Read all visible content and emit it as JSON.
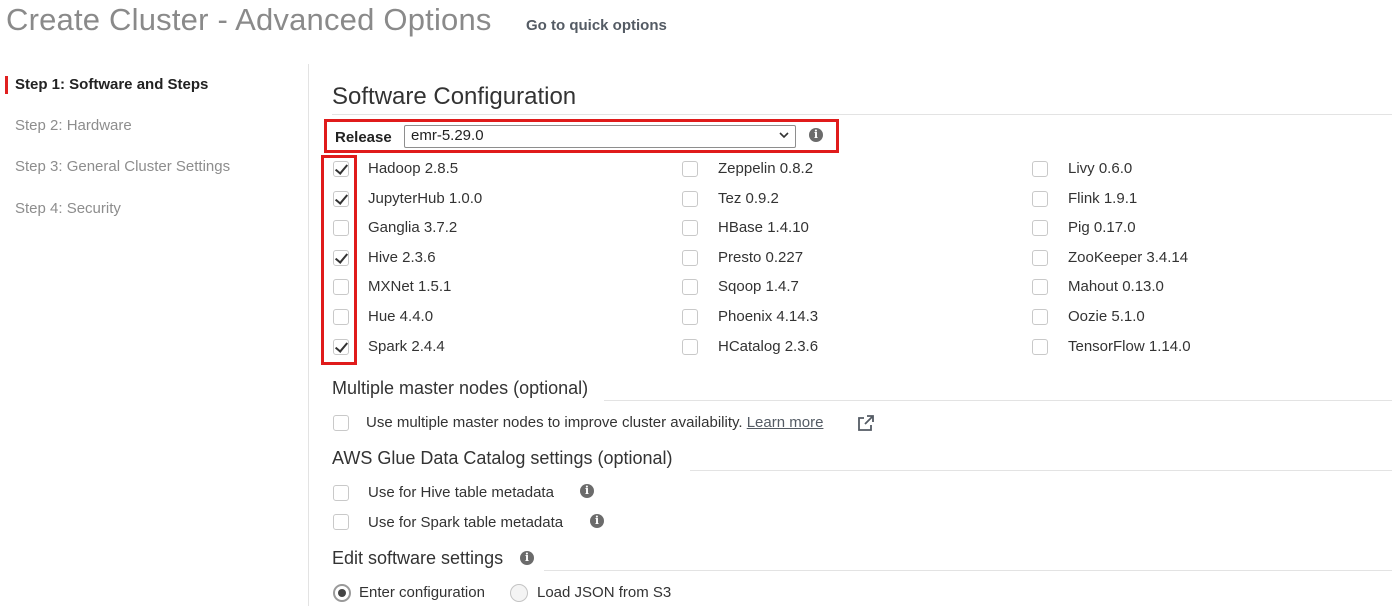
{
  "header": {
    "title": "Create Cluster - Advanced Options",
    "quick_link": "Go to quick options"
  },
  "sidebar": {
    "steps": [
      {
        "label": "Step 1: Software and Steps",
        "active": true
      },
      {
        "label": "Step 2: Hardware",
        "active": false
      },
      {
        "label": "Step 3: General Cluster Settings",
        "active": false
      },
      {
        "label": "Step 4: Security",
        "active": false
      }
    ]
  },
  "software": {
    "section_title": "Software Configuration",
    "release_label": "Release",
    "release_value": "emr-5.29.0",
    "applications": [
      [
        {
          "label": "Hadoop 2.8.5",
          "checked": true
        },
        {
          "label": "JupyterHub 1.0.0",
          "checked": true
        },
        {
          "label": "Ganglia 3.7.2",
          "checked": false
        },
        {
          "label": "Hive 2.3.6",
          "checked": true
        },
        {
          "label": "MXNet 1.5.1",
          "checked": false
        },
        {
          "label": "Hue 4.4.0",
          "checked": false
        },
        {
          "label": "Spark 2.4.4",
          "checked": true
        }
      ],
      [
        {
          "label": "Zeppelin 0.8.2",
          "checked": false
        },
        {
          "label": "Tez 0.9.2",
          "checked": false
        },
        {
          "label": "HBase 1.4.10",
          "checked": false
        },
        {
          "label": "Presto 0.227",
          "checked": false
        },
        {
          "label": "Sqoop 1.4.7",
          "checked": false
        },
        {
          "label": "Phoenix 4.14.3",
          "checked": false
        },
        {
          "label": "HCatalog 2.3.6",
          "checked": false
        }
      ],
      [
        {
          "label": "Livy 0.6.0",
          "checked": false
        },
        {
          "label": "Flink 1.9.1",
          "checked": false
        },
        {
          "label": "Pig 0.17.0",
          "checked": false
        },
        {
          "label": "ZooKeeper 3.4.14",
          "checked": false
        },
        {
          "label": "Mahout 0.13.0",
          "checked": false
        },
        {
          "label": "Oozie 5.1.0",
          "checked": false
        },
        {
          "label": "TensorFlow 1.14.0",
          "checked": false
        }
      ]
    ]
  },
  "multi_master": {
    "title": "Multiple master nodes (optional)",
    "label": "Use multiple master nodes to improve cluster availability.",
    "link": "Learn more",
    "checked": false
  },
  "glue": {
    "title": "AWS Glue Data Catalog settings (optional)",
    "hive_label": "Use for Hive table metadata",
    "spark_label": "Use for Spark table metadata",
    "hive_checked": false,
    "spark_checked": false
  },
  "edit_settings": {
    "title": "Edit software settings",
    "options": [
      {
        "label": "Enter configuration",
        "selected": true
      },
      {
        "label": "Load JSON from S3",
        "selected": false
      }
    ]
  },
  "icons": {
    "info": "info-icon",
    "external_link": "external-link-icon",
    "chevron": "chevron-down-icon"
  },
  "colors": {
    "highlight": "#e01b1b",
    "active_marker": "#e02020"
  }
}
